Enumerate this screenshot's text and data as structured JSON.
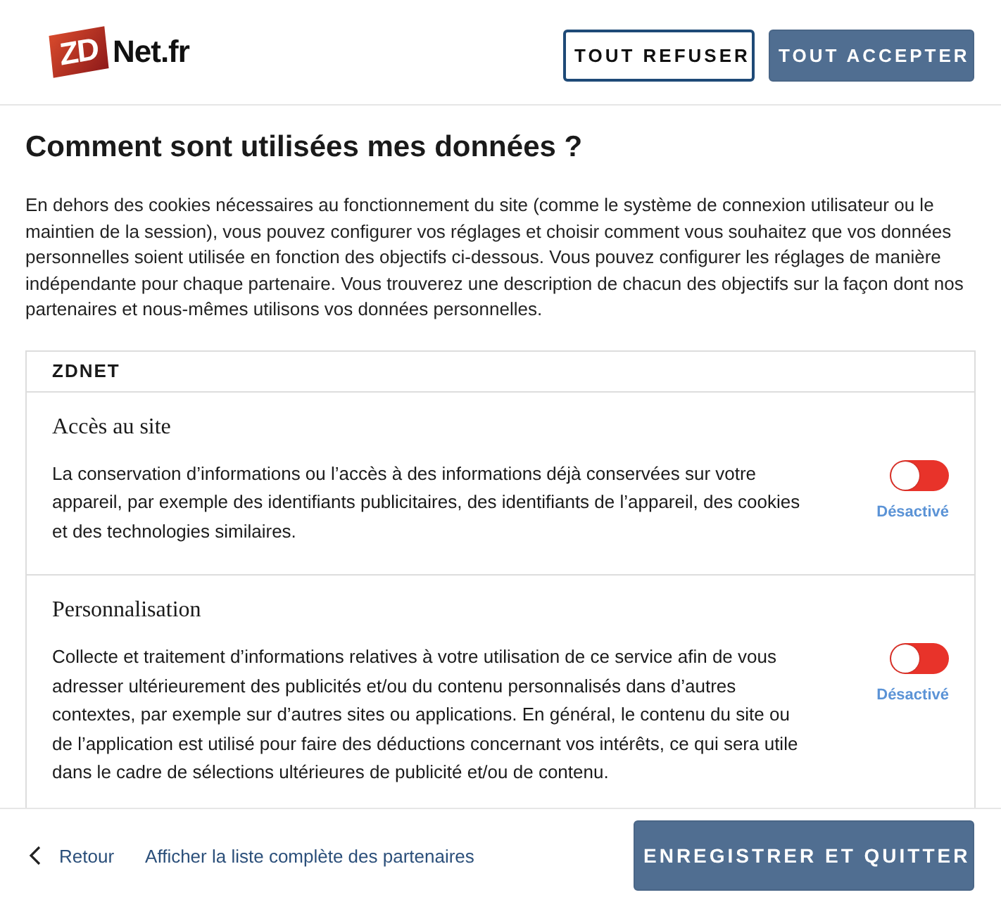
{
  "logo": {
    "mark": "ZD",
    "name": "Net.fr"
  },
  "header_buttons": [
    {
      "label": "TOUT REFUSER",
      "kind": "outline"
    },
    {
      "label": "TOUT ACCEPTER",
      "kind": "primary"
    }
  ],
  "title": "Comment sont utilisées mes données ?",
  "intro": "En dehors des cookies nécessaires au fonctionnement du site (comme le système de connexion utilisateur ou le maintien de la session), vous pouvez configurer vos réglages et choisir comment vous souhaitez que vos données personnelles soient utilisée en fonction des objectifs ci-dessous. Vous pouvez configurer les réglages de manière indépendante pour chaque partenaire. Vous trouverez une description de chacun des objectifs sur la façon dont nos partenaires et nous-mêmes utilisons vos données personnelles.",
  "section": {
    "heading": "ZDNET",
    "purposes": [
      {
        "title": "Accès au site",
        "description": "La conservation d’informations ou l’accès à des informations déjà conservées sur votre appareil, par exemple des identifiants publicitaires, des identifiants de l’appareil, des cookies et des technologies similaires.",
        "on": false,
        "status": "Désactivé"
      },
      {
        "title": "Personnalisation",
        "description": "Collecte et traitement d’informations relatives à votre utilisation de ce service afin de vous adresser ultérieurement des publicités et/ou du contenu personnalisés dans d’autres contextes, par exemple sur d’autres sites ou applications. En général, le contenu du site ou de l’application est utilisé pour faire des déductions concernant vos intérêts, ce qui sera utile dans le cadre de sélections ultérieures de publicité et/ou de contenu.",
        "on": false,
        "status": "Désactivé"
      }
    ]
  },
  "footer": {
    "back": "Retour",
    "partners_link": "Afficher la liste complète des partenaires",
    "save_button": "ENREGISTRER ET QUITTER"
  }
}
